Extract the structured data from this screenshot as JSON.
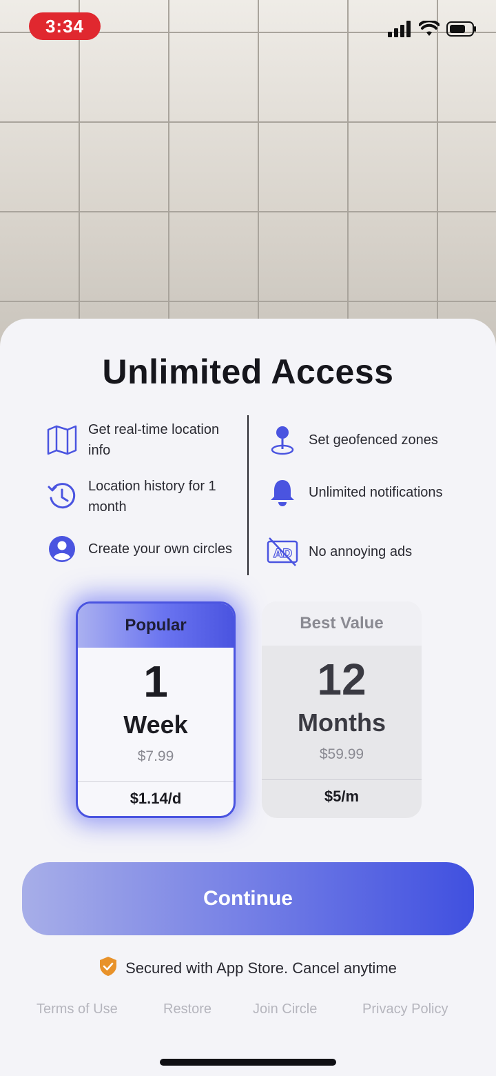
{
  "status_bar": {
    "time": "3:34"
  },
  "paywall": {
    "title": "Unlimited Access",
    "features_left": [
      {
        "icon": "map-icon",
        "text": "Get real-time location info"
      },
      {
        "icon": "history-icon",
        "text": "Location history for 1 month"
      },
      {
        "icon": "person-icon",
        "text": "Create your own circles"
      }
    ],
    "features_right": [
      {
        "icon": "location-pin-icon",
        "text": "Set geofenced zones"
      },
      {
        "icon": "bell-icon",
        "text": "Unlimited notifications"
      },
      {
        "icon": "no-ads-icon",
        "text": "No annoying ads"
      }
    ],
    "plans": [
      {
        "badge": "Popular",
        "number": "1",
        "unit": "Week",
        "price": "$7.99",
        "per": "$1.14/d",
        "selected": true
      },
      {
        "badge": "Best Value",
        "number": "12",
        "unit": "Months",
        "price": "$59.99",
        "per": "$5/m",
        "selected": false
      }
    ],
    "continue_label": "Continue",
    "secured_text": "Secured with App Store. Cancel anytime",
    "footer": {
      "terms": "Terms of Use",
      "restore": "Restore",
      "join": "Join Circle",
      "privacy": "Privacy Policy"
    }
  },
  "colors": {
    "accent": "#4a54e0",
    "time_pill": "#e0282f",
    "shield": "#e8922a"
  }
}
